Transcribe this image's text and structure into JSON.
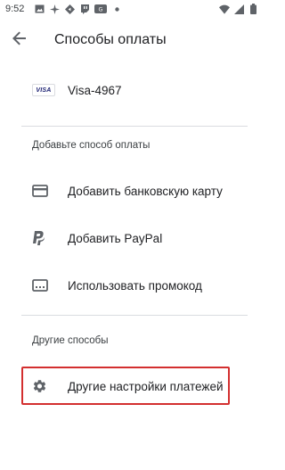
{
  "status_bar": {
    "time": "9:52",
    "left_icons": [
      "gallery-icon",
      "pinwheel-icon",
      "nav-diamond-icon",
      "twitch-icon",
      "ru-app-icon",
      "dot-icon"
    ],
    "right_icons": [
      "wifi-icon",
      "signal-icon",
      "battery-icon"
    ]
  },
  "header": {
    "title": "Способы оплаты",
    "back_icon": "arrow-back-icon"
  },
  "saved_methods": [
    {
      "icon": "visa-card-icon",
      "brand": "VISA",
      "label": "Visa-4967"
    }
  ],
  "add_section": {
    "header": "Добавьте способ оплаты",
    "items": [
      {
        "icon": "credit-card-icon",
        "label": "Добавить банковскую карту"
      },
      {
        "icon": "paypal-icon",
        "label": "Добавить PayPal"
      },
      {
        "icon": "promo-code-icon",
        "label": "Использовать промокод"
      }
    ]
  },
  "other_section": {
    "header": "Другие способы",
    "items": [
      {
        "icon": "gear-icon",
        "label": "Другие настройки платежей"
      }
    ]
  },
  "colors": {
    "highlight_border": "#d32f2f",
    "divider": "#dadce0",
    "icon": "#5f6368"
  }
}
